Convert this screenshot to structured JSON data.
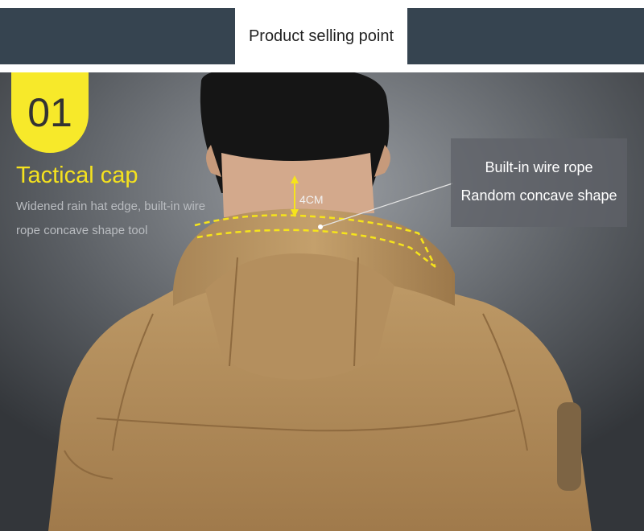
{
  "header": {
    "title": "Product selling point"
  },
  "feature": {
    "number": "01",
    "title": "Tactical cap",
    "description": "Widened rain hat edge, built-in wire rope concave shape tool"
  },
  "callout": {
    "line1": "Built-in wire rope",
    "line2": "Random concave shape"
  },
  "measurement": {
    "label": "4CM"
  },
  "colors": {
    "header_bar": "#364450",
    "accent_yellow": "#f7e92a",
    "jacket_khaki": "#b08a5a"
  }
}
